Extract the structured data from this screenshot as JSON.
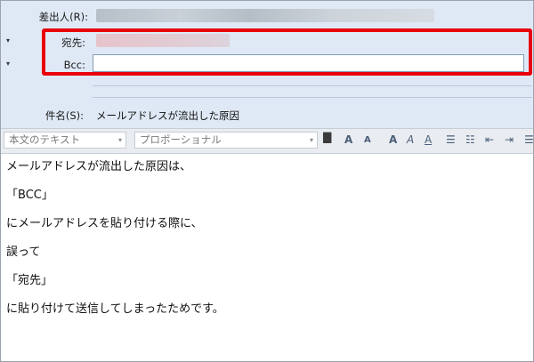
{
  "header": {
    "from_label": "差出人(R):",
    "to_label": "宛先:",
    "bcc_label": "Bcc:",
    "subject_label": "件名(S):",
    "subject_value": "メールアドレスが流出した原因"
  },
  "toolbar": {
    "style_combo": "本文のテキスト",
    "font_combo": "プロポーショナル",
    "dropdown_glyph": "▾",
    "text_color_glyph": "▇",
    "grow_font": "A",
    "shrink_font": "A",
    "bold": "A",
    "italic": "A",
    "underline": "A",
    "bullet_list": "☰",
    "numbered_list": "☷",
    "outdent": "⇤",
    "indent": "⇥",
    "more": "☰"
  },
  "body_lines": [
    "メールアドレスが流出した原因は、",
    "「BCC」",
    "にメールアドレスを貼り付ける際に、",
    "誤って",
    "「宛先」",
    "に貼り付けて送信してしまったためです。"
  ],
  "colors": {
    "header_bg": "#dfe9f5",
    "highlight": "#e8000b",
    "toolbar_bg": "#e9edf2"
  }
}
